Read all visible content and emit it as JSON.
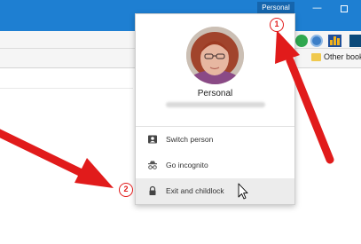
{
  "window": {
    "profile_button_label": "Personal",
    "minimize_glyph": "—",
    "accent_color": "#1e7fd2"
  },
  "bookmarks_bar": {
    "other_bookmarks_label": "Other book"
  },
  "extensions": [
    "green-extension-icon",
    "blue-extension-icon",
    "bar-chart-extension-icon",
    "book-extension-icon"
  ],
  "profile_menu": {
    "name": "Personal",
    "email": "",
    "items": [
      {
        "label": "Switch person",
        "icon": "person-card-icon"
      },
      {
        "label": "Go incognito",
        "icon": "incognito-icon"
      },
      {
        "label": "Exit and childlock",
        "icon": "lock-icon",
        "hovered": true
      }
    ]
  },
  "annotations": {
    "badges": [
      "1",
      "2"
    ],
    "arrow_color": "#e11b1b"
  }
}
